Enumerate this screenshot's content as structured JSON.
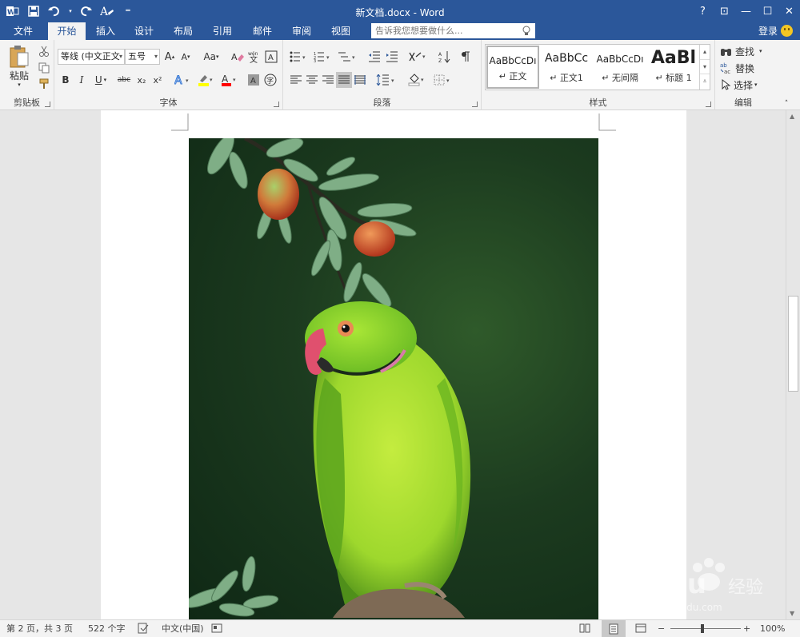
{
  "window": {
    "title": "新文档.docx - Word",
    "controls": [
      "?",
      "⊡",
      "—",
      "☐",
      "✕"
    ]
  },
  "tabs": [
    {
      "label": "文件"
    },
    {
      "label": "开始"
    },
    {
      "label": "插入"
    },
    {
      "label": "设计"
    },
    {
      "label": "布局"
    },
    {
      "label": "引用"
    },
    {
      "label": "邮件"
    },
    {
      "label": "审阅"
    },
    {
      "label": "视图"
    }
  ],
  "tell_me": {
    "placeholder": "告诉我您想要做什么..."
  },
  "account": {
    "login": "登录"
  },
  "clipboard": {
    "paste_label": "粘贴",
    "group_label": "剪贴板"
  },
  "font": {
    "font_name": "等线 (中文正文",
    "font_size": "五号",
    "group_label": "字体",
    "bold": "B",
    "italic": "I",
    "underline": "U",
    "strike": "abc",
    "subscript": "x₂",
    "superscript": "x²",
    "change_case": "Aa",
    "grow": "A",
    "shrink": "A"
  },
  "paragraph": {
    "group_label": "段落"
  },
  "styles": {
    "group_label": "样式",
    "items": [
      {
        "sample": "AaBbCcDı",
        "name": "正文"
      },
      {
        "sample": "AaBbCc",
        "name": "正文1"
      },
      {
        "sample": "AaBbCcDı",
        "name": "无间隔"
      },
      {
        "sample": "AaBl",
        "name": "标题 1"
      }
    ]
  },
  "editing": {
    "group_label": "编辑",
    "find": "查找",
    "replace": "替换",
    "select": "选择"
  },
  "status": {
    "page": "第 2 页，共 3 页",
    "words": "522 个字",
    "language": "中文(中国)",
    "zoom": "100%",
    "zoom_minus": "−",
    "zoom_plus": "+"
  },
  "watermark": {
    "text_main": "Baidu",
    "text_cn": "经验",
    "url": "jingyan.baidu.com"
  },
  "colors": {
    "accent": "#2b579a",
    "highlight": "#ffff00",
    "font_color": "#ff0000"
  }
}
